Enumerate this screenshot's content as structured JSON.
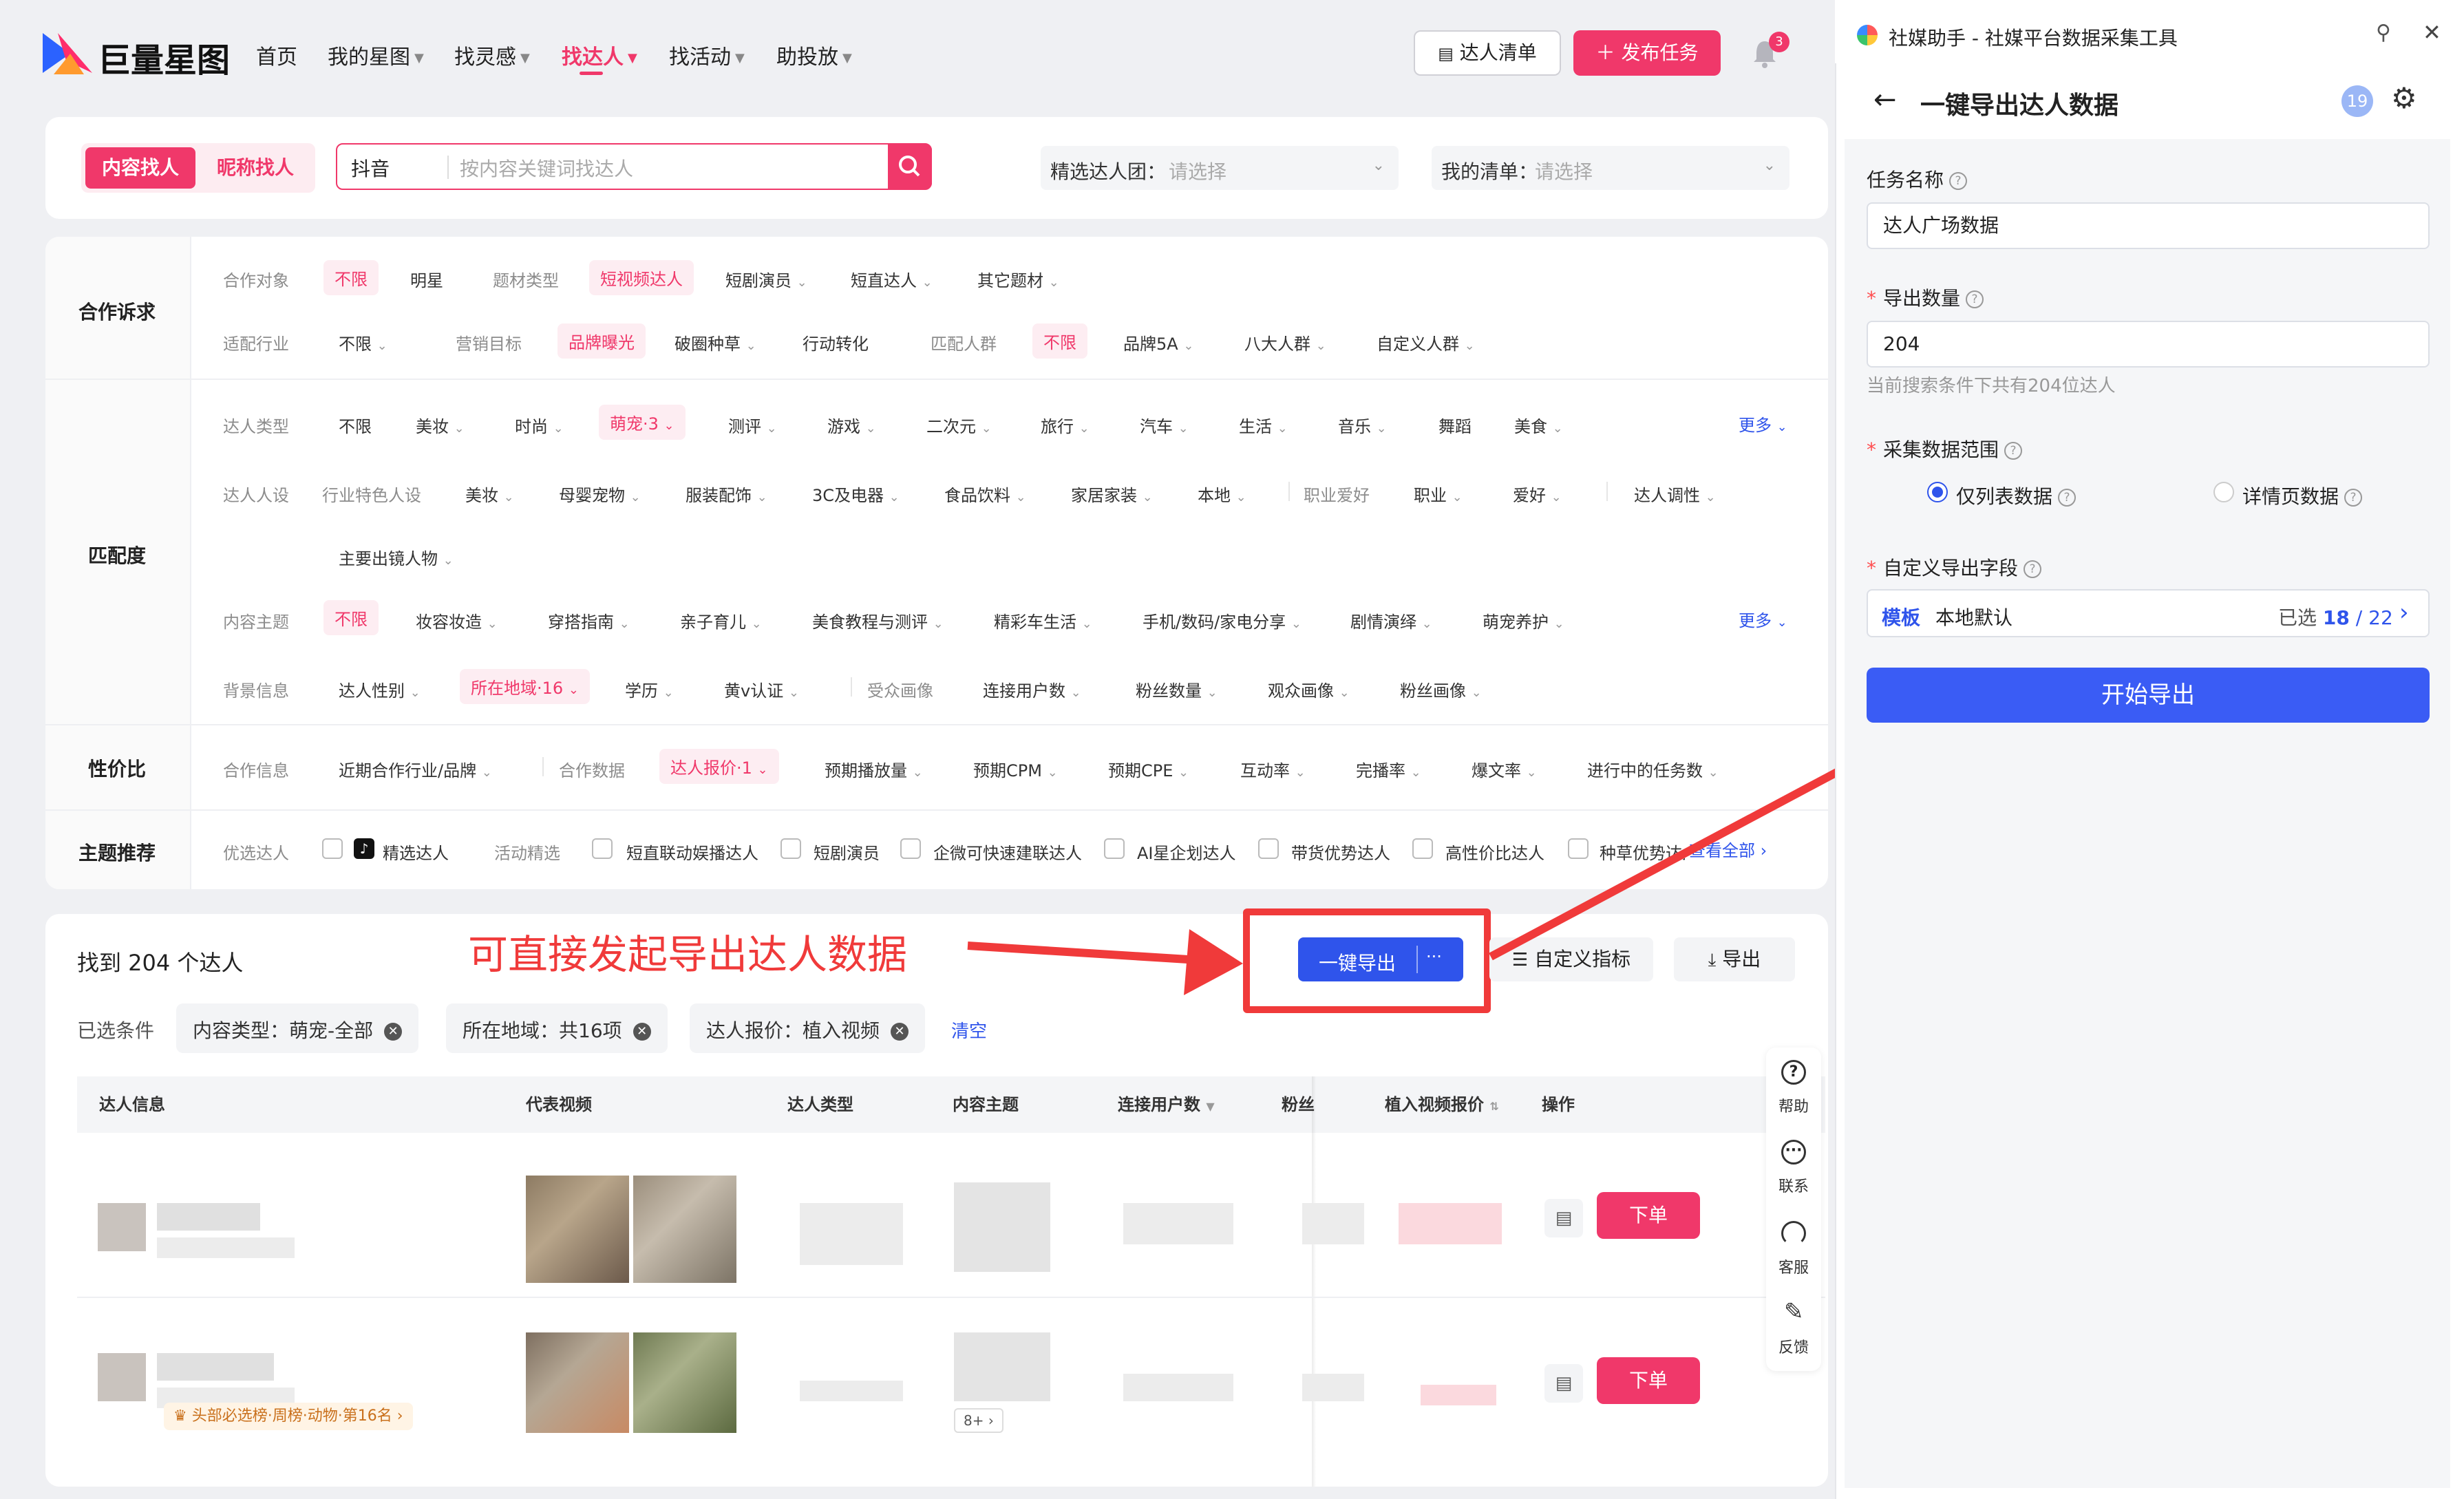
{
  "app": {
    "logo_text": "巨量星图"
  },
  "nav": {
    "home": "首页",
    "my_xingtu": "我的星图",
    "inspiration": "找灵感",
    "find_talent": "找达人",
    "activity": "找活动",
    "promote": "助投放"
  },
  "header": {
    "talent_list_btn": "达人清单",
    "publish_btn": "发布任务",
    "notif_count": "3"
  },
  "search": {
    "tab_content": "内容找人",
    "tab_nickname": "昵称找人",
    "platform": "抖音",
    "placeholder": "按内容关键词找达人",
    "group_label": "精选达人团：",
    "group_placeholder": "请选择",
    "list_label": "我的清单：",
    "list_placeholder": "请选择"
  },
  "filters": {
    "sec1": "合作诉求",
    "sec2": "匹配度",
    "sec3": "性价比",
    "sec4": "主题推荐",
    "row1": {
      "label": "合作对象",
      "items": [
        "不限",
        "明星",
        "题材类型",
        "短视频达人",
        "短剧演员",
        "短直达人",
        "其它题材"
      ]
    },
    "row2": {
      "label": "适配行业",
      "items": [
        "不限",
        "营销目标",
        "品牌曝光",
        "破圈种草",
        "行动转化",
        "匹配人群",
        "不限",
        "品牌5A",
        "八大人群",
        "自定义人群"
      ]
    },
    "row3": {
      "label": "达人类型",
      "items": [
        "不限",
        "美妆",
        "时尚",
        "萌宠·3",
        "测评",
        "游戏",
        "二次元",
        "旅行",
        "汽车",
        "生活",
        "音乐",
        "舞蹈",
        "美食"
      ],
      "more": "更多"
    },
    "row4": {
      "label": "达人人设",
      "items": [
        "行业特色人设",
        "美妆",
        "母婴宠物",
        "服装配饰",
        "3C及电器",
        "食品饮料",
        "家居家装",
        "本地",
        "职业爱好",
        "职业",
        "爱好",
        "达人调性",
        "主要出镜人物"
      ]
    },
    "row5": {
      "label": "内容主题",
      "items": [
        "不限",
        "妆容妆造",
        "穿搭指南",
        "亲子育儿",
        "美食教程与测评",
        "精彩车生活",
        "手机/数码/家电分享",
        "剧情演绎",
        "萌宠养护"
      ],
      "more": "更多"
    },
    "row6": {
      "label": "背景信息",
      "items": [
        "达人性别",
        "所在地域·16",
        "学历",
        "黄v认证",
        "受众画像",
        "连接用户数",
        "粉丝数量",
        "观众画像",
        "粉丝画像"
      ]
    },
    "row7": {
      "label": "合作信息",
      "items": [
        "近期合作行业/品牌",
        "合作数据",
        "达人报价·1",
        "预期播放量",
        "预期CPM",
        "预期CPE",
        "互动率",
        "完播率",
        "爆文率",
        "进行中的任务数"
      ]
    },
    "row8": {
      "label": "优选达人",
      "items": [
        "精选达人",
        "活动精选",
        "短直联动娱播达人",
        "短剧演员",
        "企微可快速建联达人",
        "AI星企划达人",
        "带货优势达人",
        "高性价比达人",
        "种草优势达人"
      ],
      "more": "查看全部"
    }
  },
  "results": {
    "found": "找到 204 个达人",
    "annotation": "可直接发起导出达人数据",
    "one_click_export": "一键导出",
    "more_dots": "···",
    "custom_metrics": "自定义指标",
    "export": "导出",
    "selected_label": "已选条件",
    "chips": [
      "内容类型：萌宠-全部",
      "所在地域：共16项",
      "达人报价：植入视频"
    ],
    "clear": "清空",
    "columns": [
      "达人信息",
      "代表视频",
      "达人类型",
      "内容主题",
      "连接用户数",
      "粉丝",
      "植入视频报价",
      "操作"
    ],
    "rows": [
      {
        "order": "下单"
      },
      {
        "order": "下单",
        "badge": "头部必选榜·周榜·动物·第16名",
        "more_tag": "8+"
      }
    ]
  },
  "side_tools": [
    "帮助",
    "联系",
    "客服",
    "反馈"
  ],
  "panel": {
    "window_title": "社媒助手 - 社媒平台数据采集工具",
    "title": "一键导出达人数据",
    "badge": "19",
    "task_name_label": "任务名称",
    "task_name_value": "达人广场数据",
    "count_label": "导出数量",
    "count_value": "204",
    "count_hint": "当前搜索条件下共有204位达人",
    "range_label": "采集数据范围",
    "range_opt1": "仅列表数据",
    "range_opt2": "详情页数据",
    "fields_label": "自定义导出字段",
    "template_label": "模板",
    "template_value": "本地默认",
    "selected_prefix": "已选",
    "selected_count": "18",
    "total_count": "/ 22",
    "start_btn": "开始导出"
  },
  "colors": {
    "brand_pink": "#f0386a",
    "primary_blue": "#2f54eb",
    "arrow_red": "#f03a3a"
  }
}
